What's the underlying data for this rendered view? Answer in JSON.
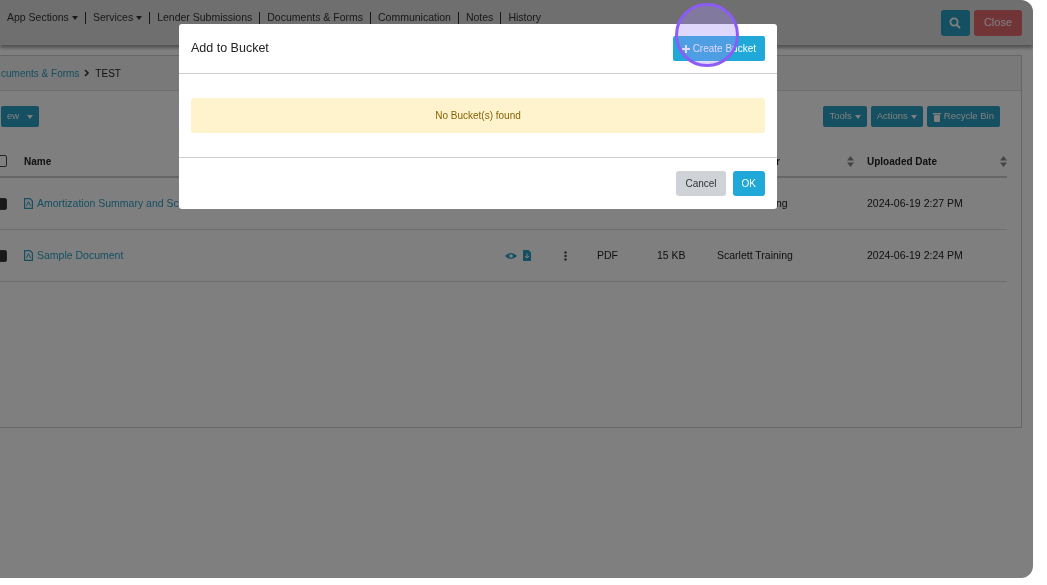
{
  "top_bar": {
    "nav_items": [
      {
        "label": "App Sections",
        "dropdown": true
      },
      {
        "label": "Services",
        "dropdown": true
      },
      {
        "label": "Lender Submissions",
        "dropdown": false
      },
      {
        "label": "Documents & Forms",
        "dropdown": false
      },
      {
        "label": "Communication",
        "dropdown": false
      },
      {
        "label": "Notes",
        "dropdown": false
      },
      {
        "label": "History",
        "dropdown": false
      }
    ],
    "close_button": "Close"
  },
  "breadcrumb": [
    {
      "label": "cuments & Forms",
      "link": true
    },
    {
      "label": "TEST",
      "link": false
    }
  ],
  "toolbar": {
    "left_buttons": [
      {
        "label": "ew",
        "dropdown": true
      }
    ],
    "right_buttons": [
      {
        "label": "Tools",
        "kind": "dropdown"
      },
      {
        "label": "Actions",
        "kind": "dropdown"
      },
      {
        "label": "Recycle Bin",
        "kind": "trash"
      }
    ]
  },
  "table": {
    "select_all_checked": false,
    "columns": [
      {
        "label": "Name",
        "sortable": false
      },
      {
        "label": "r",
        "sortable": true
      },
      {
        "label": "Uploaded Date",
        "sortable": true
      }
    ],
    "rows": [
      {
        "checked": true,
        "name": "Amortization Summary and Sc",
        "uploaded_by": "ng",
        "uploaded_date": "2024-06-19 2:27 PM"
      },
      {
        "checked": true,
        "name": "Sample Document",
        "actions": true,
        "type": "PDF",
        "size": "15 KB",
        "uploaded_by": "Scarlett Training",
        "uploaded_date": "2024-06-19 2:24 PM"
      }
    ]
  },
  "modal": {
    "title": "Add to Bucket",
    "create_button": "Create Bucket",
    "alert": "No Bucket(s) found",
    "buttons": [
      {
        "label": "Cancel",
        "kind": "secondary"
      },
      {
        "label": "OK",
        "kind": "primary"
      }
    ]
  }
}
